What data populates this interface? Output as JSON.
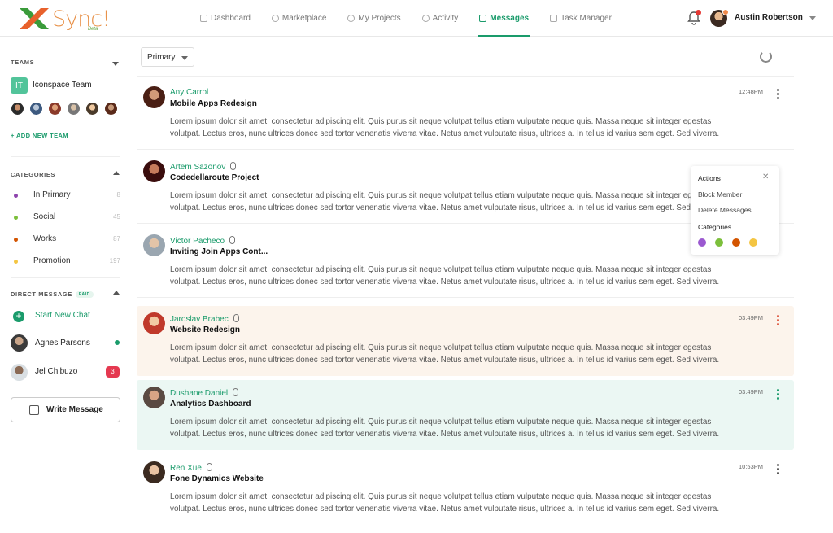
{
  "app": {
    "brand": "Sync!",
    "brand_tag": "Beta"
  },
  "nav": [
    {
      "label": "Dashboard",
      "icon": "grid-icon"
    },
    {
      "label": "Marketplace",
      "icon": "search-icon"
    },
    {
      "label": "My Projects",
      "icon": "check-circle-icon"
    },
    {
      "label": "Activity",
      "icon": "clock-icon"
    },
    {
      "label": "Messages",
      "icon": "chat-icon",
      "active": true
    },
    {
      "label": "Task Manager",
      "icon": "clipboard-icon"
    }
  ],
  "user": {
    "name": "Austin Robertson"
  },
  "sidebar": {
    "teams_title": "TEAMS",
    "team": {
      "initials": "IT",
      "name": "Iconspace Team"
    },
    "add_team": "+ ADD NEW TEAM",
    "categories_title": "CATEGORIES",
    "categories": [
      {
        "label": "In Primary",
        "count": "8",
        "color": "#8e44ad"
      },
      {
        "label": "Social",
        "count": "45",
        "color": "#7cbf3b"
      },
      {
        "label": "Works",
        "count": "87",
        "color": "#d35400"
      },
      {
        "label": "Promotion",
        "count": "197",
        "color": "#f4c542"
      }
    ],
    "dm_title": "DIRECT MESSAGE",
    "dm_badge": "PAID",
    "start_chat": "Start New Chat",
    "dms": [
      {
        "name": "Agnes Parsons"
      },
      {
        "name": "Jel Chibuzo",
        "unread": "3"
      }
    ],
    "write_message": "Write Message"
  },
  "filter": {
    "selected": "Primary"
  },
  "messages": [
    {
      "sender": "Any Carrol",
      "subject": "Mobile Apps Redesign",
      "time": "12:48PM",
      "attachment": false,
      "body": "Lorem ipsum dolor sit amet, consectetur adipiscing elit. Quis purus sit neque volutpat tellus etiam vulputate neque quis. Massa neque sit integer egestas volutpat. Lectus eros, nunc ultrices donec sed tortor venenatis viverra vitae. Netus amet vulputate risus, ultrices a. In tellus id varius sem eget. Sed viverra."
    },
    {
      "sender": "Artem Sazonov",
      "subject": "Codedellaroute Project",
      "time": "",
      "attachment": true,
      "body": "Lorem ipsum dolor sit amet, consectetur adipiscing elit. Quis purus sit neque volutpat tellus etiam vulputate neque quis. Massa neque sit integer egestas volutpat. Lectus eros, nunc ultrices donec sed tortor venenatis viverra vitae. Netus amet vulputate risus, ultrices a. In tellus id varius sem eget. Sed viverra."
    },
    {
      "sender": "Victor Pacheco",
      "subject": "Inviting Join Apps Cont...",
      "time": "",
      "attachment": true,
      "body": "Lorem ipsum dolor sit amet, consectetur adipiscing elit. Quis purus sit neque volutpat tellus etiam vulputate neque quis. Massa neque sit integer egestas volutpat. Lectus eros, nunc ultrices donec sed tortor venenatis viverra vitae. Netus amet vulputate risus, ultrices a. In tellus id varius sem eget. Sed viverra."
    },
    {
      "sender": "Jaroslav Brabec",
      "subject": "Website Redesign",
      "time": "03:49PM",
      "attachment": true,
      "body": "Lorem ipsum dolor sit amet, consectetur adipiscing elit. Quis purus sit neque volutpat tellus etiam vulputate neque quis. Massa neque sit integer egestas volutpat. Lectus eros, nunc ultrices donec sed tortor venenatis viverra vitae. Netus amet vulputate risus, ultrices a. In tellus id varius sem eget. Sed viverra."
    },
    {
      "sender": "Dushane Daniel",
      "subject": "Analytics Dashboard",
      "time": "03:49PM",
      "attachment": true,
      "body": "Lorem ipsum dolor sit amet, consectetur adipiscing elit. Quis purus sit neque volutpat tellus etiam vulputate neque quis. Massa neque sit integer egestas volutpat. Lectus eros, nunc ultrices donec sed tortor venenatis viverra vitae. Netus amet vulputate risus, ultrices a. In tellus id varius sem eget. Sed viverra."
    },
    {
      "sender": "Ren Xue",
      "subject": "Fone Dynamics Website",
      "time": "10:53PM",
      "attachment": true,
      "body": "Lorem ipsum dolor sit amet, consectetur adipiscing elit. Quis purus sit neque volutpat tellus etiam vulputate neque quis. Massa neque sit integer egestas volutpat. Lectus eros, nunc ultrices donec sed tortor venenatis viverra vitae. Netus amet vulputate risus, ultrices a. In tellus id varius sem eget. Sed viverra."
    }
  ],
  "actions_popup": {
    "title": "Actions",
    "items": [
      "Block Member",
      "Delete Messages"
    ],
    "categories_label": "Categories",
    "colors": [
      "#9b59d0",
      "#7cbf3b",
      "#d35400",
      "#f4c542"
    ]
  },
  "colors": {
    "accent": "#1a9b6b",
    "highlight_peach": "#fcf4ec",
    "highlight_mint": "#ebf7f3",
    "alert": "#e53950"
  }
}
